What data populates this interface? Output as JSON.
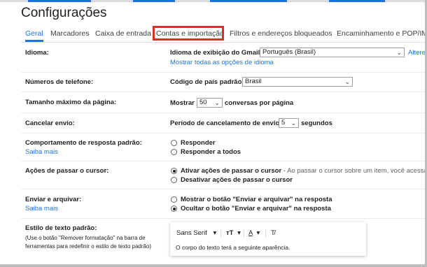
{
  "page": {
    "title": "Configurações"
  },
  "tabs": [
    {
      "label": "Geral",
      "active": true
    },
    {
      "label": "Marcadores"
    },
    {
      "label": "Caixa de entrada"
    },
    {
      "label": "Contas e importação",
      "highlighted": true
    },
    {
      "label": "Filtros e endereços bloqueados"
    },
    {
      "label": "Encaminhamento e POP/IMA"
    }
  ],
  "settings": {
    "language": {
      "label": "Idioma:",
      "display_label": "Idioma de exibição do Gmail:",
      "selected": "Português (Brasil)",
      "change_link": "Altere a",
      "show_all_link": "Mostrar todas as opções de idioma"
    },
    "phone": {
      "label": "Números de telefone:",
      "country_label": "Código de país padrão:",
      "selected": "Brasil"
    },
    "page_size": {
      "label": "Tamanho máximo da página:",
      "prefix": "Mostrar",
      "selected": "50",
      "suffix": "conversas por página"
    },
    "undo_send": {
      "label": "Cancelar envio:",
      "period_label": "Período de cancelamento de envio:",
      "selected": "5",
      "suffix": "segundos"
    },
    "reply_default": {
      "label": "Comportamento de resposta padrão:",
      "learn_more": "Saiba mais",
      "options": [
        "Responder",
        "Responder a todos"
      ]
    },
    "hover_actions": {
      "label": "Ações de passar o cursor:",
      "option_on": "Ativar ações de passar o cursor",
      "option_on_desc": " - Ao passar o cursor sobre um item, você acessa",
      "option_off": "Desativar ações de passar o cursor"
    },
    "send_archive": {
      "label": "Enviar e arquivar:",
      "learn_more": "Saiba mais",
      "option_show": "Mostrar o botão \"Enviar e arquivar\" na resposta",
      "option_hide": "Ocultar o botão \"Enviar e arquivar\" na resposta"
    },
    "text_style": {
      "label": "Estilo de texto padrão:",
      "note_line1": "(Use o botão \"Remover formatação\" na barra de",
      "note_line2": "ferramentas para redefinir o estilo de texto padrão)",
      "font": "Sans Serif",
      "size_glyph": "тT",
      "color_glyph": "A",
      "clear_glyph": "T̸",
      "dropdown_glyph": "▾",
      "sample": "O corpo do texto terá a seguinte aparência."
    }
  },
  "colors": {
    "accent": "#1a73e8",
    "highlight": "#d93025",
    "text": "#202124"
  }
}
